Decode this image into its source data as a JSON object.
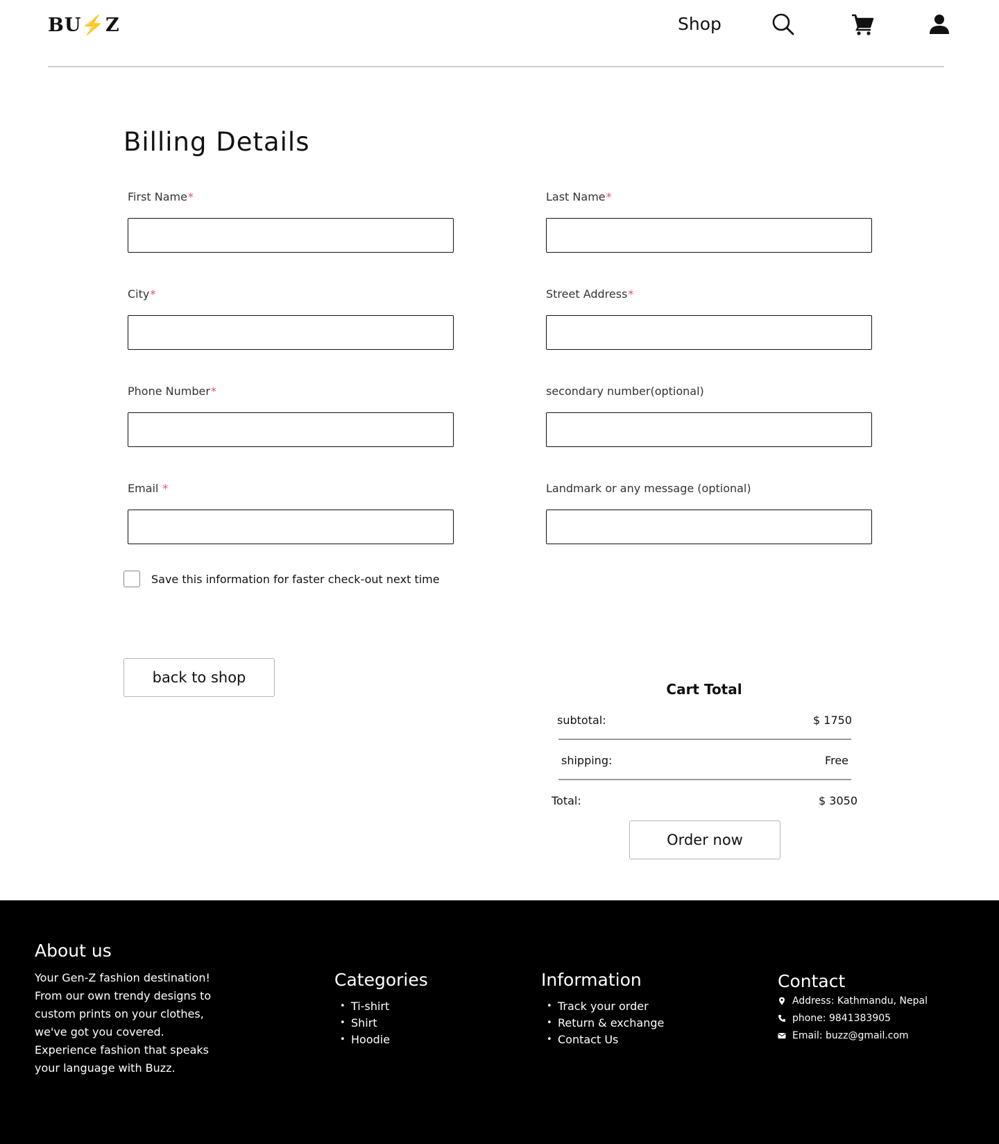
{
  "header": {
    "logo": "BU⚡Z",
    "nav_shop": "Shop",
    "icons": [
      "search-icon",
      "cart-icon",
      "user-icon"
    ]
  },
  "billing": {
    "title": "Billing Details",
    "required_mark": "*",
    "fields": {
      "first_name": {
        "label": "First Name",
        "value": ""
      },
      "last_name": {
        "label": "Last Name",
        "value": ""
      },
      "city": {
        "label": "City",
        "value": ""
      },
      "street": {
        "label": "Street Address",
        "value": ""
      },
      "phone": {
        "label": "Phone Number",
        "value": ""
      },
      "secondary": {
        "label": "secondary number(optional)",
        "value": ""
      },
      "email": {
        "label": "Email",
        "value": ""
      },
      "landmark": {
        "label": "Landmark or any message (optional)",
        "value": ""
      }
    },
    "save_info_label": "Save this information for faster check-out next time",
    "save_info_checked": false,
    "back_button": "back to shop"
  },
  "cart": {
    "title": "Cart Total",
    "subtotal_label": "subtotal:",
    "subtotal_value": "$ 1750",
    "shipping_label": "shipping:",
    "shipping_value": "Free",
    "total_label": "Total:",
    "total_value": "$ 3050",
    "order_button": "Order now"
  },
  "footer": {
    "about": {
      "title": "About us",
      "text": "Your Gen-Z fashion destination! From our own trendy designs to custom prints on your clothes, we've got you covered. Experience fashion that speaks your language with Buzz."
    },
    "categories": {
      "title": "Categories",
      "items": [
        "Ti-shirt",
        "Shirt",
        "Hoodie"
      ]
    },
    "information": {
      "title": "Information",
      "items": [
        "Track your order",
        "Return & exchange",
        "Contact Us"
      ]
    },
    "contact": {
      "title": "Contact",
      "address": "Address: Kathmandu, Nepal",
      "phone": "phone: 9841383905",
      "email": "Email: buzz@gmail.com",
      "icons": [
        "location-pin-icon",
        "phone-icon",
        "mail-icon"
      ]
    }
  },
  "colors": {
    "required": "#e8505b",
    "footer_bg": "#000000",
    "text": "#111111"
  }
}
